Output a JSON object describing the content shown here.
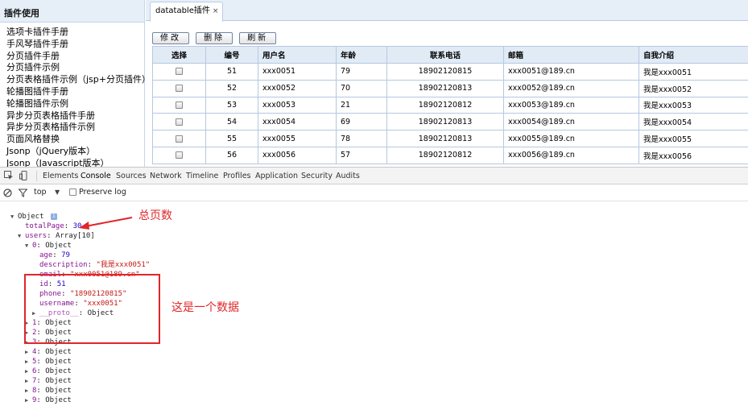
{
  "sidebar": {
    "title": "插件使用",
    "items": [
      "选项卡插件手册",
      "手风琴插件手册",
      "分页插件手册",
      "分页插件示例",
      "分页表格插件示例（jsp+分页插件）",
      "轮播图插件手册",
      "轮播图插件示例",
      "异步分页表格插件手册",
      "异步分页表格插件示例",
      "页面风格替换",
      "Jsonp（jQuery版本）",
      "Jsonp（Javascript版本）"
    ]
  },
  "tab": {
    "label": "datatable插件",
    "close": "×"
  },
  "toolbar": {
    "edit": "修改",
    "delete": "删除",
    "refresh": "刷新"
  },
  "table": {
    "headers": [
      "选择",
      "编号",
      "用户名",
      "年龄",
      "联系电话",
      "邮箱",
      "自我介绍"
    ],
    "rows": [
      [
        "51",
        "xxx0051",
        "79",
        "18902120815",
        "xxx0051@189.cn",
        "我是xxx0051"
      ],
      [
        "52",
        "xxx0052",
        "70",
        "18902120813",
        "xxx0052@189.cn",
        "我是xxx0052"
      ],
      [
        "53",
        "xxx0053",
        "21",
        "18902120812",
        "xxx0053@189.cn",
        "我是xxx0053"
      ],
      [
        "54",
        "xxx0054",
        "69",
        "18902120813",
        "xxx0054@189.cn",
        "我是xxx0054"
      ],
      [
        "55",
        "xxx0055",
        "78",
        "18902120813",
        "xxx0055@189.cn",
        "我是xxx0055"
      ],
      [
        "56",
        "xxx0056",
        "57",
        "18902120812",
        "xxx0056@189.cn",
        "我是xxx0056"
      ]
    ]
  },
  "devtools": {
    "tabs": [
      "Elements",
      "Console",
      "Sources",
      "Network",
      "Timeline",
      "Profiles",
      "Application",
      "Security",
      "Audits"
    ],
    "active_tab": "Console",
    "filter": {
      "context": "top",
      "preserve_log": "Preserve log"
    }
  },
  "console": {
    "root": "Object",
    "total_page_key": "totalPage",
    "total_page_value": "30",
    "users_key": "users",
    "users_value": "Array[10]",
    "item0_key": "0",
    "item0_value": "Object",
    "fields": [
      {
        "key": "age",
        "value": "79",
        "kind": "num"
      },
      {
        "key": "description",
        "value": "\"我是xxx0051\"",
        "kind": "str"
      },
      {
        "key": "email",
        "value": "\"xxx0051@189.cn\"",
        "kind": "str"
      },
      {
        "key": "id",
        "value": "51",
        "kind": "num"
      },
      {
        "key": "phone",
        "value": "\"18902120815\"",
        "kind": "str"
      },
      {
        "key": "username",
        "value": "\"xxx0051\"",
        "kind": "str"
      }
    ],
    "proto_key": "__proto__",
    "proto_value": "Object",
    "other_items": [
      {
        "key": "1",
        "value": "Object"
      },
      {
        "key": "2",
        "value": "Object"
      },
      {
        "key": "3",
        "value": "Object"
      },
      {
        "key": "4",
        "value": "Object"
      },
      {
        "key": "5",
        "value": "Object"
      },
      {
        "key": "6",
        "value": "Object"
      },
      {
        "key": "7",
        "value": "Object"
      },
      {
        "key": "8",
        "value": "Object"
      },
      {
        "key": "9",
        "value": "Object"
      }
    ]
  },
  "annotations": {
    "total_pages": "总页数",
    "one_record": "这是一个数据"
  },
  "colors": {
    "annotation_red": "#e0262a",
    "header_blue": "#e1ebf6"
  }
}
